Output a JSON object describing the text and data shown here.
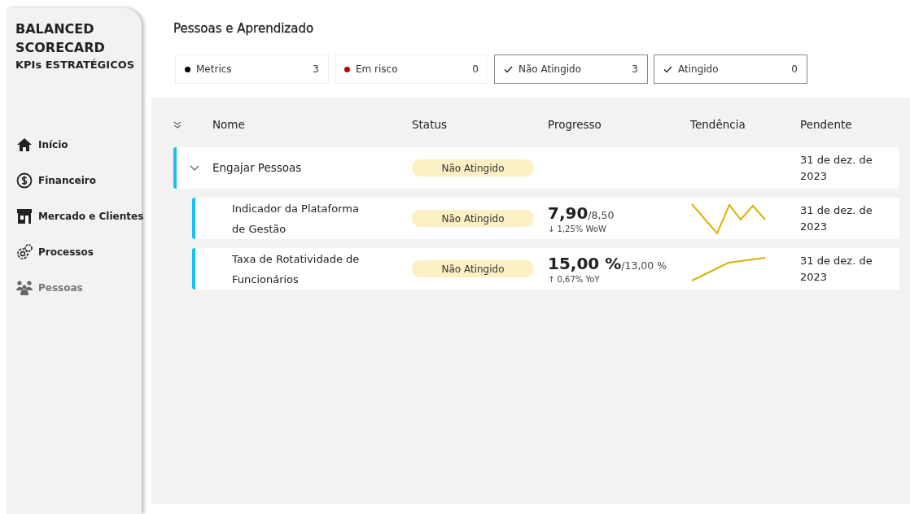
{
  "sidebar": {
    "title_lines": [
      "BALANCED",
      "SCORECARD"
    ],
    "subtitle": "KPIs ESTRATÉGICOS",
    "items": [
      {
        "label": "Início",
        "selected": false
      },
      {
        "label": "Financeiro",
        "selected": false
      },
      {
        "label": "Mercado e Clientes",
        "selected": false
      },
      {
        "label": "Processos",
        "selected": false
      },
      {
        "label": "Pessoas",
        "selected": true
      }
    ]
  },
  "page_title": "Pessoas e Aprendizado",
  "filters": [
    {
      "kind": "dot",
      "label": "Metrics",
      "count": "3",
      "color": "#000000"
    },
    {
      "kind": "dot",
      "label": "Em risco",
      "count": "0",
      "color": "#c00000"
    },
    {
      "kind": "check",
      "label": "Não Atingido",
      "count": "3"
    },
    {
      "kind": "check",
      "label": "Atingido",
      "count": "0"
    }
  ],
  "table": {
    "columns": [
      "Nome",
      "Status",
      "Progresso",
      "Tendência",
      "Pendente"
    ],
    "rows": [
      {
        "name": "Engajar Pessoas",
        "status": "Não Atingido",
        "due": "31 de dez. de 2023",
        "expanded": true,
        "children": [
          {
            "name": "Indicador da Plataforma de Gestão",
            "status": "Não Atingido",
            "value": "7,90",
            "target": "/8,50",
            "change_arrow": "↓",
            "change": "1,25% WoW",
            "due": "31 de dez. de 2023"
          },
          {
            "name": "Taxa de Rotatividade de Funcionários",
            "status": "Não Atingido",
            "value": "15,00 %",
            "target": "/13,00 %",
            "change_arrow": "↑",
            "change": "0,67% YoY",
            "due": "31 de dez. de 2023"
          }
        ]
      }
    ]
  }
}
